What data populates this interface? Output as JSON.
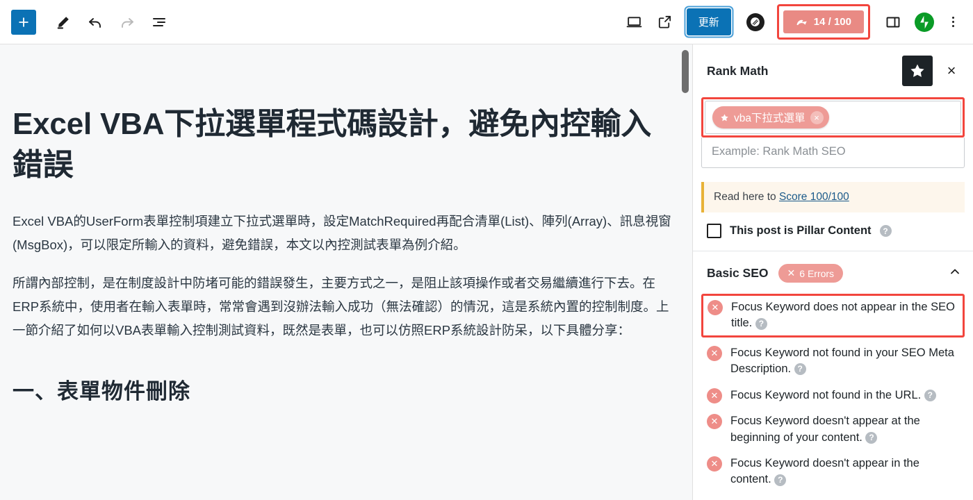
{
  "toolbar": {
    "add_label": "+",
    "icons": [
      {
        "name": "add-block-button",
        "label": "+"
      },
      {
        "name": "edit-pencil-icon",
        "label": "Edit"
      },
      {
        "name": "undo-icon",
        "label": "Undo"
      },
      {
        "name": "redo-icon",
        "label": "Redo"
      },
      {
        "name": "document-overview-icon",
        "label": "Document Overview"
      },
      {
        "name": "preview-desktop-icon",
        "label": "Preview"
      },
      {
        "name": "view-post-icon",
        "label": "View Post"
      }
    ],
    "update_label": "更新",
    "seo_score": "14 / 100",
    "seo_score_value": 14,
    "seo_score_max": 100
  },
  "editor": {
    "title": "Excel VBA下拉選單程式碼設計，避免內控輸入錯誤",
    "paragraph1": "Excel VBA的UserForm表單控制項建立下拉式選單時，設定MatchRequired再配合清單(List)、陣列(Array)、訊息視窗(MsgBox)，可以限定所輸入的資料，避免錯誤，本文以內控測試表單為例介紹。",
    "paragraph2": "所謂內部控制，是在制度設計中防堵可能的錯誤發生，主要方式之一，是阻止該項操作或者交易繼續進行下去。在ERP系統中，使用者在輸入表單時，常常會遇到沒辦法輸入成功（無法確認）的情況，這是系統內置的控制制度。上一節介紹了如何以VBA表單輸入控制測試資料，既然是表單，也可以仿照ERP系統設計防呆，以下具體分享：",
    "heading2": "一、表單物件刪除"
  },
  "rank_math": {
    "title": "Rank Math",
    "close_label": "×",
    "keyword_chip": "vba下拉式選單",
    "keyword_chip_remove": "×",
    "keyword_placeholder": "Example: Rank Math SEO",
    "notice_prefix": "Read here to ",
    "notice_link": "Score 100/100",
    "pillar_label": "This post is Pillar Content",
    "help_glyph": "?",
    "basic_seo": {
      "title": "Basic SEO",
      "errors_badge": "6 Errors",
      "errors_count": 6,
      "items": [
        {
          "text": "Focus Keyword does not appear in the SEO title.",
          "annotated": true
        },
        {
          "text": "Focus Keyword not found in your SEO Meta Description.",
          "annotated": false
        },
        {
          "text": "Focus Keyword not found in the URL.",
          "annotated": false
        },
        {
          "text": "Focus Keyword doesn't appear at the beginning of your content.",
          "annotated": false
        },
        {
          "text": "Focus Keyword doesn't appear in the content.",
          "annotated": false
        }
      ]
    }
  },
  "colors": {
    "accent_blue": "#0b72b5",
    "annotation_red": "#f2453d",
    "error_salmon": "#ee9b96",
    "score_badge_bg": "#e98a84",
    "jetpack_green": "#0a9b26",
    "notice_yellow": "#e8b238"
  }
}
